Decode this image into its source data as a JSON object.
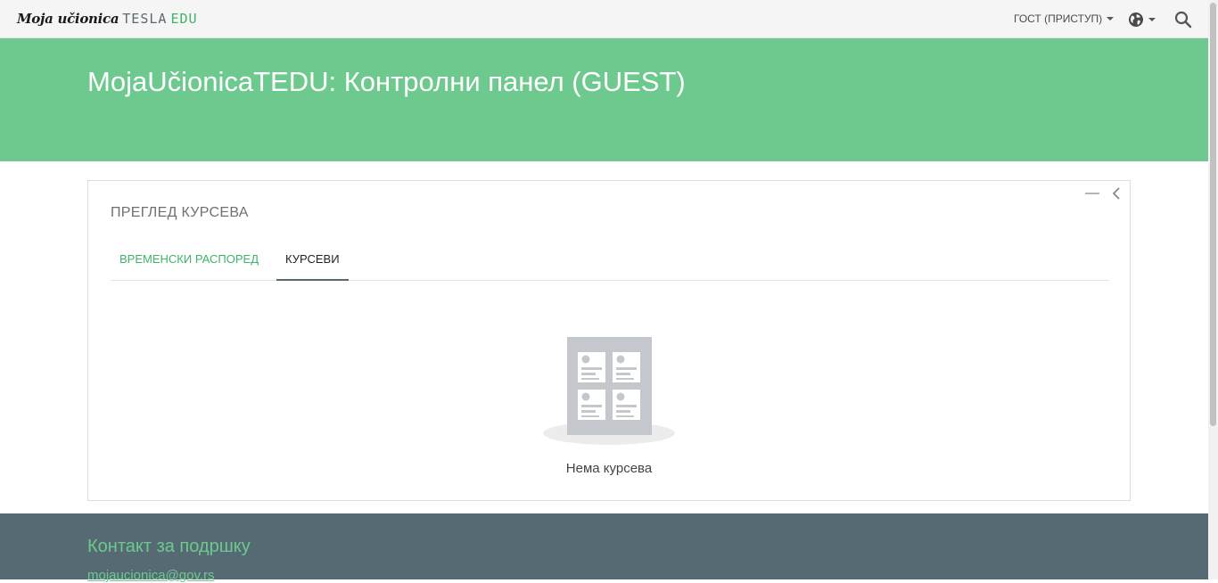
{
  "navbar": {
    "brand_script": "Moja učionica",
    "brand_tesla": "TESLA",
    "brand_edu": "EDU",
    "user_menu_label": "ГОСТ (ПРИСТУП)"
  },
  "header": {
    "title": "MojaUčionicaTEDU: Контролни панел (GUEST)"
  },
  "card": {
    "title": "ПРЕГЛЕД КУРСЕВА",
    "tabs": [
      {
        "label": "ВРЕМЕНСКИ РАСПОРЕД",
        "active": false
      },
      {
        "label": "КУРСЕВИ",
        "active": true
      }
    ],
    "empty_text": "Нема курсева"
  },
  "footer": {
    "title": "Контакт за подршку",
    "email": "mojaucionica@gov.rs"
  },
  "colors": {
    "accent_green": "#6ec98f",
    "link_green": "#3fb36a",
    "footer_bg": "#566a74",
    "navbar_bg": "#f5f5f5"
  },
  "icons": [
    "globe-icon",
    "search-icon",
    "chevron-left-icon",
    "minus-icon",
    "caret-down-icon"
  ]
}
